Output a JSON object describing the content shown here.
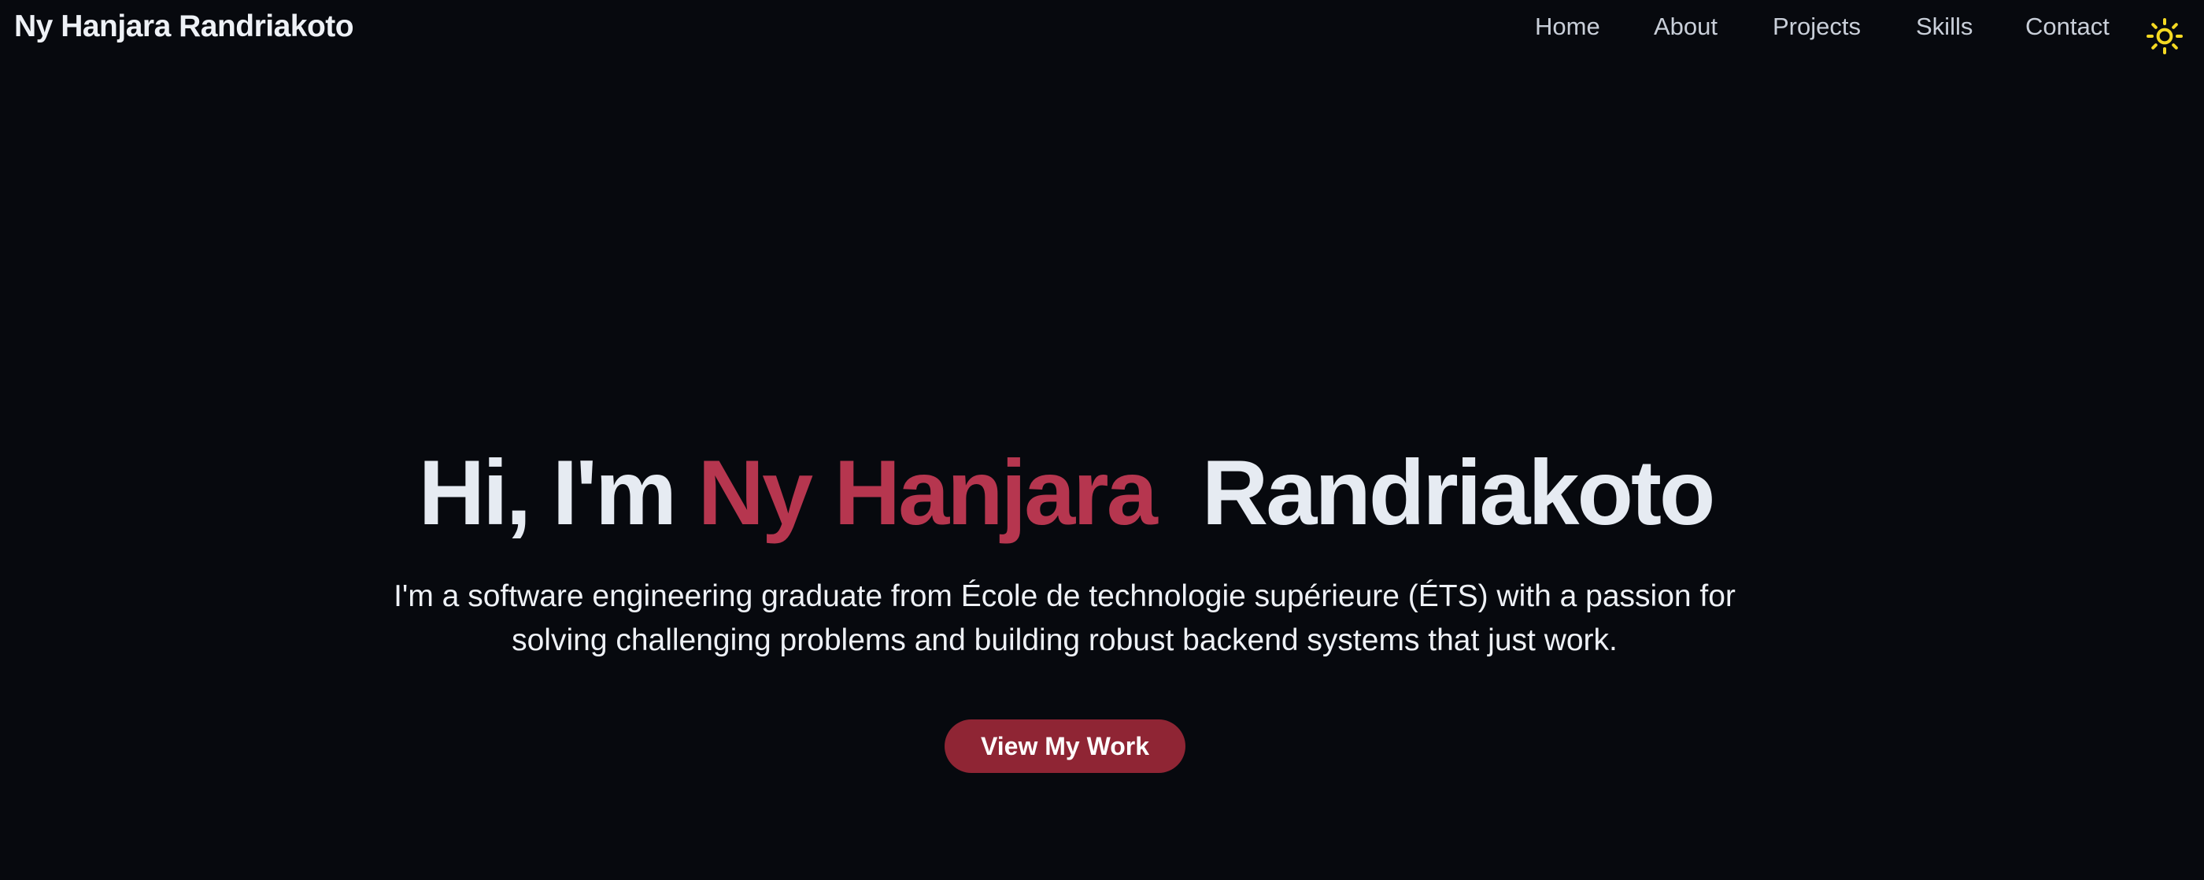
{
  "navbar": {
    "brand": "Ny Hanjara Randriakoto",
    "links": [
      {
        "label": "Home"
      },
      {
        "label": "About"
      },
      {
        "label": "Projects"
      },
      {
        "label": "Skills"
      },
      {
        "label": "Contact"
      }
    ],
    "theme_toggle_icon": "sun-icon",
    "theme_toggle_color": "#f5d922"
  },
  "hero": {
    "greeting": "Hi, I'm ",
    "first_name": "Ny Hanjara",
    "last_name": "Randriakoto",
    "description": "I'm a software engineering graduate from École de technologie supérieure (ÉTS) with a passion for solving challenging problems and building robust backend systems that just work.",
    "cta_label": "View My Work"
  },
  "colors": {
    "background": "#07090e",
    "accent": "#b6364f",
    "button": "#8f2534",
    "text": "#e6ebf2"
  }
}
